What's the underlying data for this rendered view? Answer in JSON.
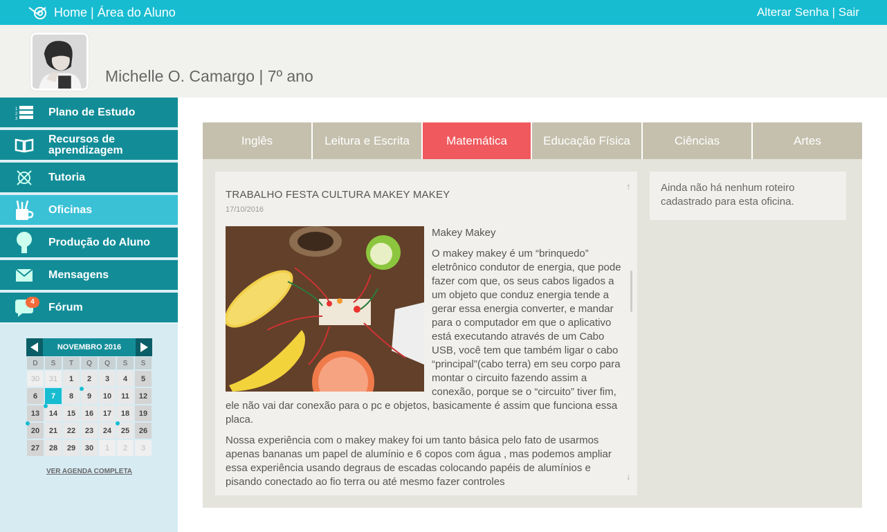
{
  "topbar": {
    "home_label": "Home | Área do Aluno",
    "right_label": "Alterar Senha | Sair"
  },
  "profile": {
    "name": "Michelle O. Camargo | 7º ano"
  },
  "sidebar": {
    "items": [
      {
        "label": "Plano de Estudo",
        "icon": "list-icon"
      },
      {
        "label": "Recursos de aprendizagem",
        "icon": "book-icon"
      },
      {
        "label": "Tutoria",
        "icon": "compass-icon"
      },
      {
        "label": "Oficinas",
        "icon": "tools-cup-icon"
      },
      {
        "label": "Produção do Aluno",
        "icon": "lightbulb-icon"
      },
      {
        "label": "Mensagens",
        "icon": "envelope-icon"
      },
      {
        "label": "Fórum",
        "icon": "chat-bubble-icon",
        "badge": "4"
      }
    ],
    "active_index": 3
  },
  "calendar": {
    "title": "NOVEMBRO 2016",
    "weekdays": [
      "D",
      "S",
      "T",
      "Q",
      "Q",
      "S",
      "S"
    ],
    "weeks": [
      [
        "30",
        "31",
        "1",
        "2",
        "3",
        "4",
        "5"
      ],
      [
        "6",
        "7",
        "8",
        "9",
        "10",
        "11",
        "12"
      ],
      [
        "13",
        "14",
        "15",
        "16",
        "17",
        "18",
        "19"
      ],
      [
        "20",
        "21",
        "22",
        "23",
        "24",
        "25",
        "26"
      ],
      [
        "27",
        "28",
        "29",
        "30",
        "1",
        "2",
        "3"
      ]
    ],
    "today": "7",
    "link": "VER AGENDA COMPLETA",
    "accent": "#17bcd1"
  },
  "tabs": {
    "items": [
      "Inglês",
      "Leitura e Escrita",
      "Matemática",
      "Educação Física",
      "Ciências",
      "Artes"
    ],
    "active_index": 2,
    "active_color": "#f0595d"
  },
  "post": {
    "title": "TRABALHO FESTA CULTURA MAKEY MAKEY",
    "date": "17/10/2016",
    "subtitle": "Makey Makey",
    "paragraph1": "O makey makey é um “brinquedo” eletrônico condutor de energia, que pode fazer com que, os seus cabos ligados a um objeto que conduz energia tende a gerar essa energia converter, e mandar para o computador em que o aplicativo está executando através de um Cabo USB, você tem que também ligar o cabo “principal”(cabo terra) em seu corpo para montar o circuito fazendo assim a conexão, porque se o “circuito” tiver fim, ele não vai dar conexão para o pc e objetos, basicamente é assim que funciona essa placa.",
    "paragraph2": "Nossa experiência com o makey makey foi um tanto básica pelo fato de usarmos apenas bananas um papel de alumínio e 6 copos com água , mas podemos ampliar essa experiência usando degraus de escadas colocando papéis de alumínios e pisando conectado ao fio terra ou até mesmo fazer controles"
  },
  "side_note": "Ainda não há nenhum roteiro cadastrado para esta oficina."
}
